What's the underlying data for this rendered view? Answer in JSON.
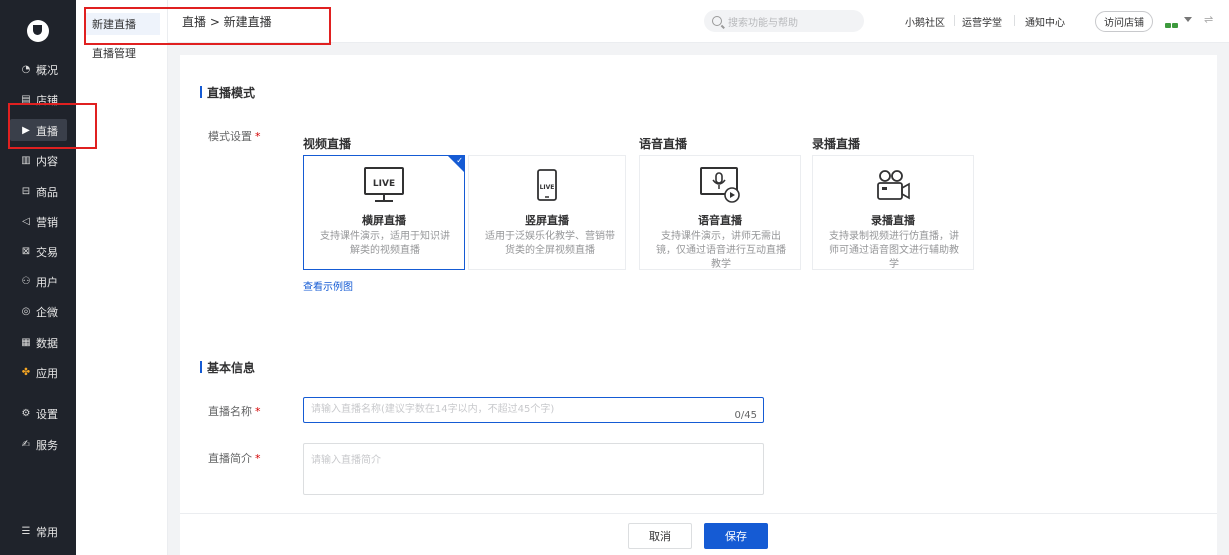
{
  "nav": {
    "items": [
      {
        "icon": "overview-icon",
        "glyph": "◔",
        "label": "概况"
      },
      {
        "icon": "store-icon",
        "glyph": "▤",
        "label": "店铺"
      },
      {
        "icon": "live-icon",
        "glyph": "▶",
        "label": "直播"
      },
      {
        "icon": "content-icon",
        "glyph": "▥",
        "label": "内容"
      },
      {
        "icon": "goods-icon",
        "glyph": "⊟",
        "label": "商品"
      },
      {
        "icon": "marketing-icon",
        "glyph": "◁",
        "label": "营销"
      },
      {
        "icon": "trade-icon",
        "glyph": "⊠",
        "label": "交易"
      },
      {
        "icon": "user-icon",
        "glyph": "⚇",
        "label": "用户"
      },
      {
        "icon": "wecom-icon",
        "glyph": "◎",
        "label": "企微"
      },
      {
        "icon": "data-icon",
        "glyph": "▦",
        "label": "数据"
      },
      {
        "icon": "apps-icon",
        "glyph": "✤",
        "label": "应用"
      },
      {
        "icon": "settings-icon",
        "glyph": "⚙",
        "label": "设置"
      },
      {
        "icon": "service-icon",
        "glyph": "✍",
        "label": "服务"
      }
    ],
    "common": {
      "icon": "menu-icon",
      "glyph": "☰",
      "label": "常用"
    }
  },
  "subnav": {
    "items": [
      "新建直播",
      "直播管理"
    ]
  },
  "header": {
    "breadcrumb": "直播 > 新建直播",
    "search_placeholder": "搜索功能与帮助",
    "links": [
      "小鹅社区",
      "运营学堂",
      "通知中心"
    ],
    "visit_store": "访问店铺",
    "switch_glyph": "⇌"
  },
  "mode_section": {
    "title": "直播模式",
    "field_label": "模式设置",
    "required": "*",
    "groups": [
      "视频直播",
      "语音直播",
      "录播直播"
    ],
    "cards": [
      {
        "title": "横屏直播",
        "desc": "支持课件演示，适用于知识讲解类的视频直播",
        "icon": "landscape-live-icon",
        "badge": "LIVE"
      },
      {
        "title": "竖屏直播",
        "desc": "适用于泛娱乐化教学、营销带货类的全屏视频直播",
        "icon": "portrait-live-icon",
        "badge": "LIVE"
      },
      {
        "title": "语音直播",
        "desc": "支持课件演示，讲师无需出镜，仅通过语音进行互动直播教学",
        "icon": "voice-live-icon"
      },
      {
        "title": "录播直播",
        "desc": "支持录制视频进行仿直播，讲师可通过语音图文进行辅助教学",
        "icon": "recorded-live-icon"
      }
    ],
    "example_link": "查看示例图"
  },
  "basic_section": {
    "title": "基本信息",
    "name_label": "直播名称",
    "name_placeholder": "请输入直播名称(建议字数在14字以内，不超过45个字)",
    "name_counter": "0/45",
    "intro_label": "直播简介",
    "intro_placeholder": "请输入直播简介",
    "required": "*"
  },
  "footer": {
    "cancel": "取消",
    "save": "保存"
  },
  "colors": {
    "accent": "#155bd4",
    "nav_bg": "#1f232b",
    "highlight": "#e02020"
  }
}
